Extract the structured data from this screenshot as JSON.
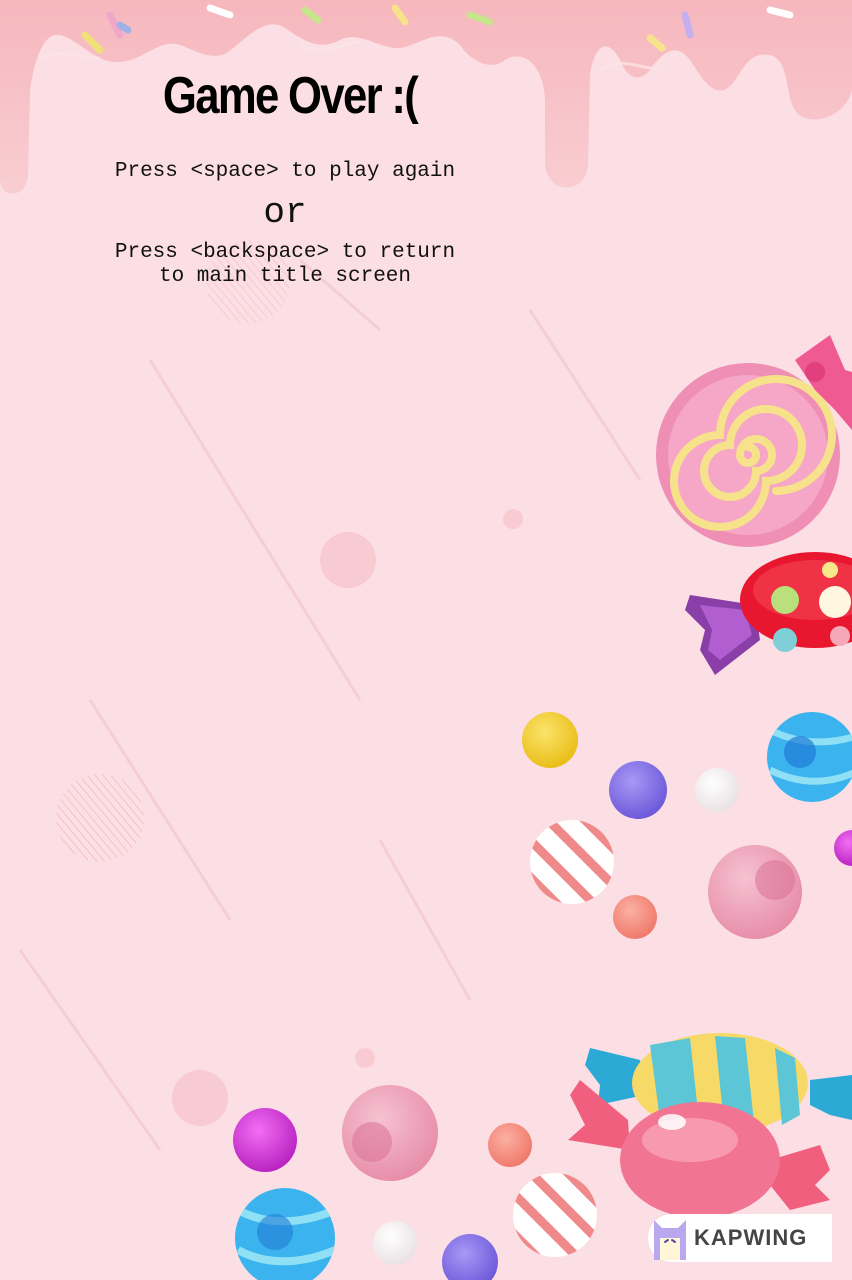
{
  "screen": {
    "title": "Game Over :(",
    "instruction_replay": "Press <space> to play again",
    "separator": "or",
    "instruction_return_line1": "Press <backspace> to return",
    "instruction_return_line2": "to main title screen"
  },
  "watermark": {
    "text": "KAPWING",
    "icon": "kapwing-cat-icon"
  },
  "colors": {
    "background": "#fbdfe4",
    "icing": "#f4c2c7",
    "text": "#000000"
  },
  "decorations": [
    "drip-icing-border",
    "lollipop",
    "wrapped-candy-red",
    "candy-balls",
    "wrapped-candy-striped"
  ]
}
